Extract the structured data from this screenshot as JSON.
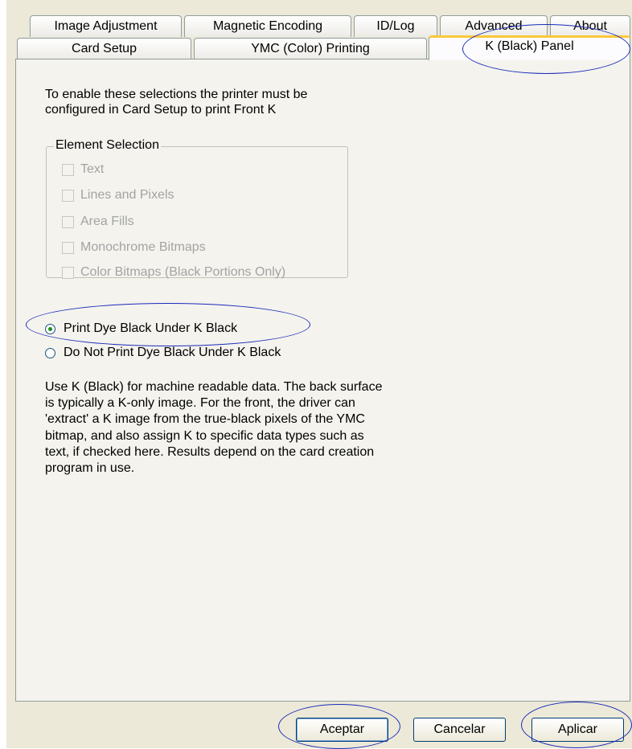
{
  "tabs": {
    "row1": [
      "Image Adjustment",
      "Magnetic Encoding",
      "ID/Log",
      "Advanced",
      "About"
    ],
    "row2": [
      "Card Setup",
      "YMC (Color) Printing",
      "K (Black) Panel"
    ]
  },
  "panel": {
    "intro_line1": "To enable these selections the printer must be",
    "intro_line2": "configured in Card Setup to print Front K",
    "element_selection": {
      "legend": "Element Selection",
      "items": [
        "Text",
        "Lines and Pixels",
        "Area Fills",
        "Monochrome Bitmaps",
        "Color Bitmaps (Black Portions Only)"
      ]
    },
    "radio_options": [
      "Print Dye Black Under K Black",
      "Do Not Print Dye Black Under K Black"
    ],
    "description_lines": [
      "Use K (Black) for machine readable data. The back surface",
      "is typically a K-only image. For the front, the driver can",
      "'extract' a K image from the true-black pixels of the YMC",
      "bitmap, and also assign K to specific data types such as",
      "text, if checked here. Results depend on the card creation",
      "program in use."
    ]
  },
  "buttons": {
    "ok": "Aceptar",
    "cancel": "Cancelar",
    "apply": "Aplicar"
  },
  "colors": {
    "tab_highlight": "#ffc83c",
    "annotation": "#1a2bb8",
    "radio_dot": "#1e8e23"
  }
}
